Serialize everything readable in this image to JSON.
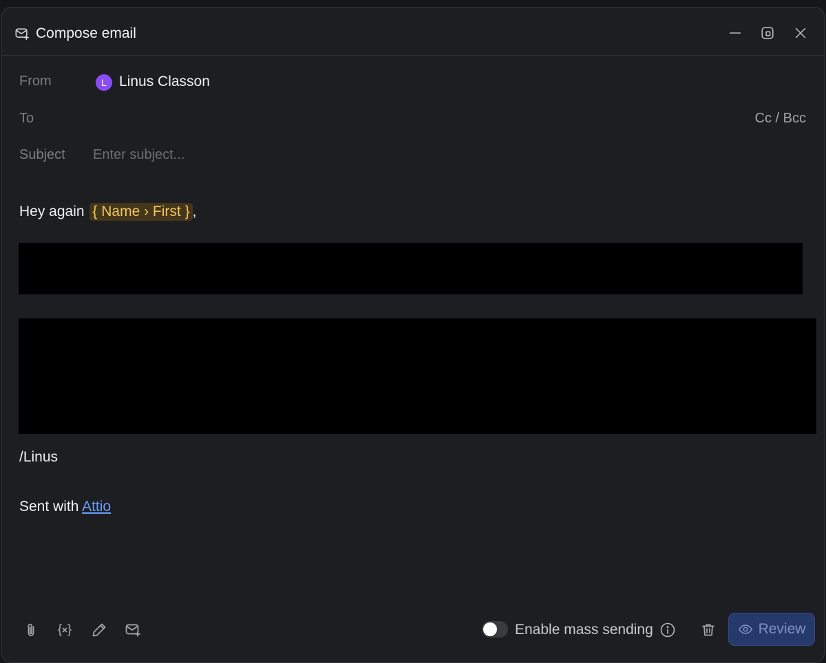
{
  "window": {
    "title": "Compose email",
    "icon": "mail-compose-icon",
    "controls": [
      "minimize-icon",
      "popout-icon",
      "close-icon"
    ]
  },
  "header": {
    "from_label": "From",
    "from_avatar_initial": "L",
    "from_avatar_color": "#8a4df5",
    "from_name": "Linus Classon",
    "to_label": "To",
    "cc_bcc_label": "Cc / Bcc",
    "subject_label": "Subject",
    "subject_value": "",
    "subject_placeholder": "Enter subject..."
  },
  "body": {
    "greeting": "Hey again",
    "variable": "{ Name › First }",
    "greeting_suffix": ",",
    "signoff": "/Linus",
    "footer_prefix": "Sent with ",
    "footer_link": "Attio"
  },
  "toolbar": {
    "icons": [
      "paperclip-icon",
      "variable-icon",
      "pen-icon",
      "template-icon"
    ],
    "mass_sending_label": "Enable mass sending",
    "mass_sending_enabled": false,
    "review_label": "Review"
  },
  "colors": {
    "background": "#1d1e22",
    "variable_chip_bg": "#43361a",
    "variable_chip_text": "#f3c560",
    "link": "#6b9dff",
    "review_button": "#26396b"
  }
}
